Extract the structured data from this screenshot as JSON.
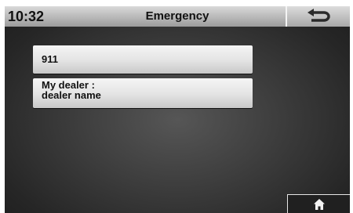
{
  "header": {
    "time": "10:32",
    "title": "Emergency",
    "back_icon": "back-arrow-icon"
  },
  "entries": [
    {
      "line1": "911",
      "line2": ""
    },
    {
      "line1": "My dealer :",
      "line2": "dealer name"
    }
  ],
  "footer": {
    "home_icon": "home-icon"
  },
  "colors": {
    "header_top": "#d9d9d9",
    "header_bottom": "#9c9c9c",
    "background": "#3b3b3b",
    "entry_background": "#e3e3e3"
  }
}
